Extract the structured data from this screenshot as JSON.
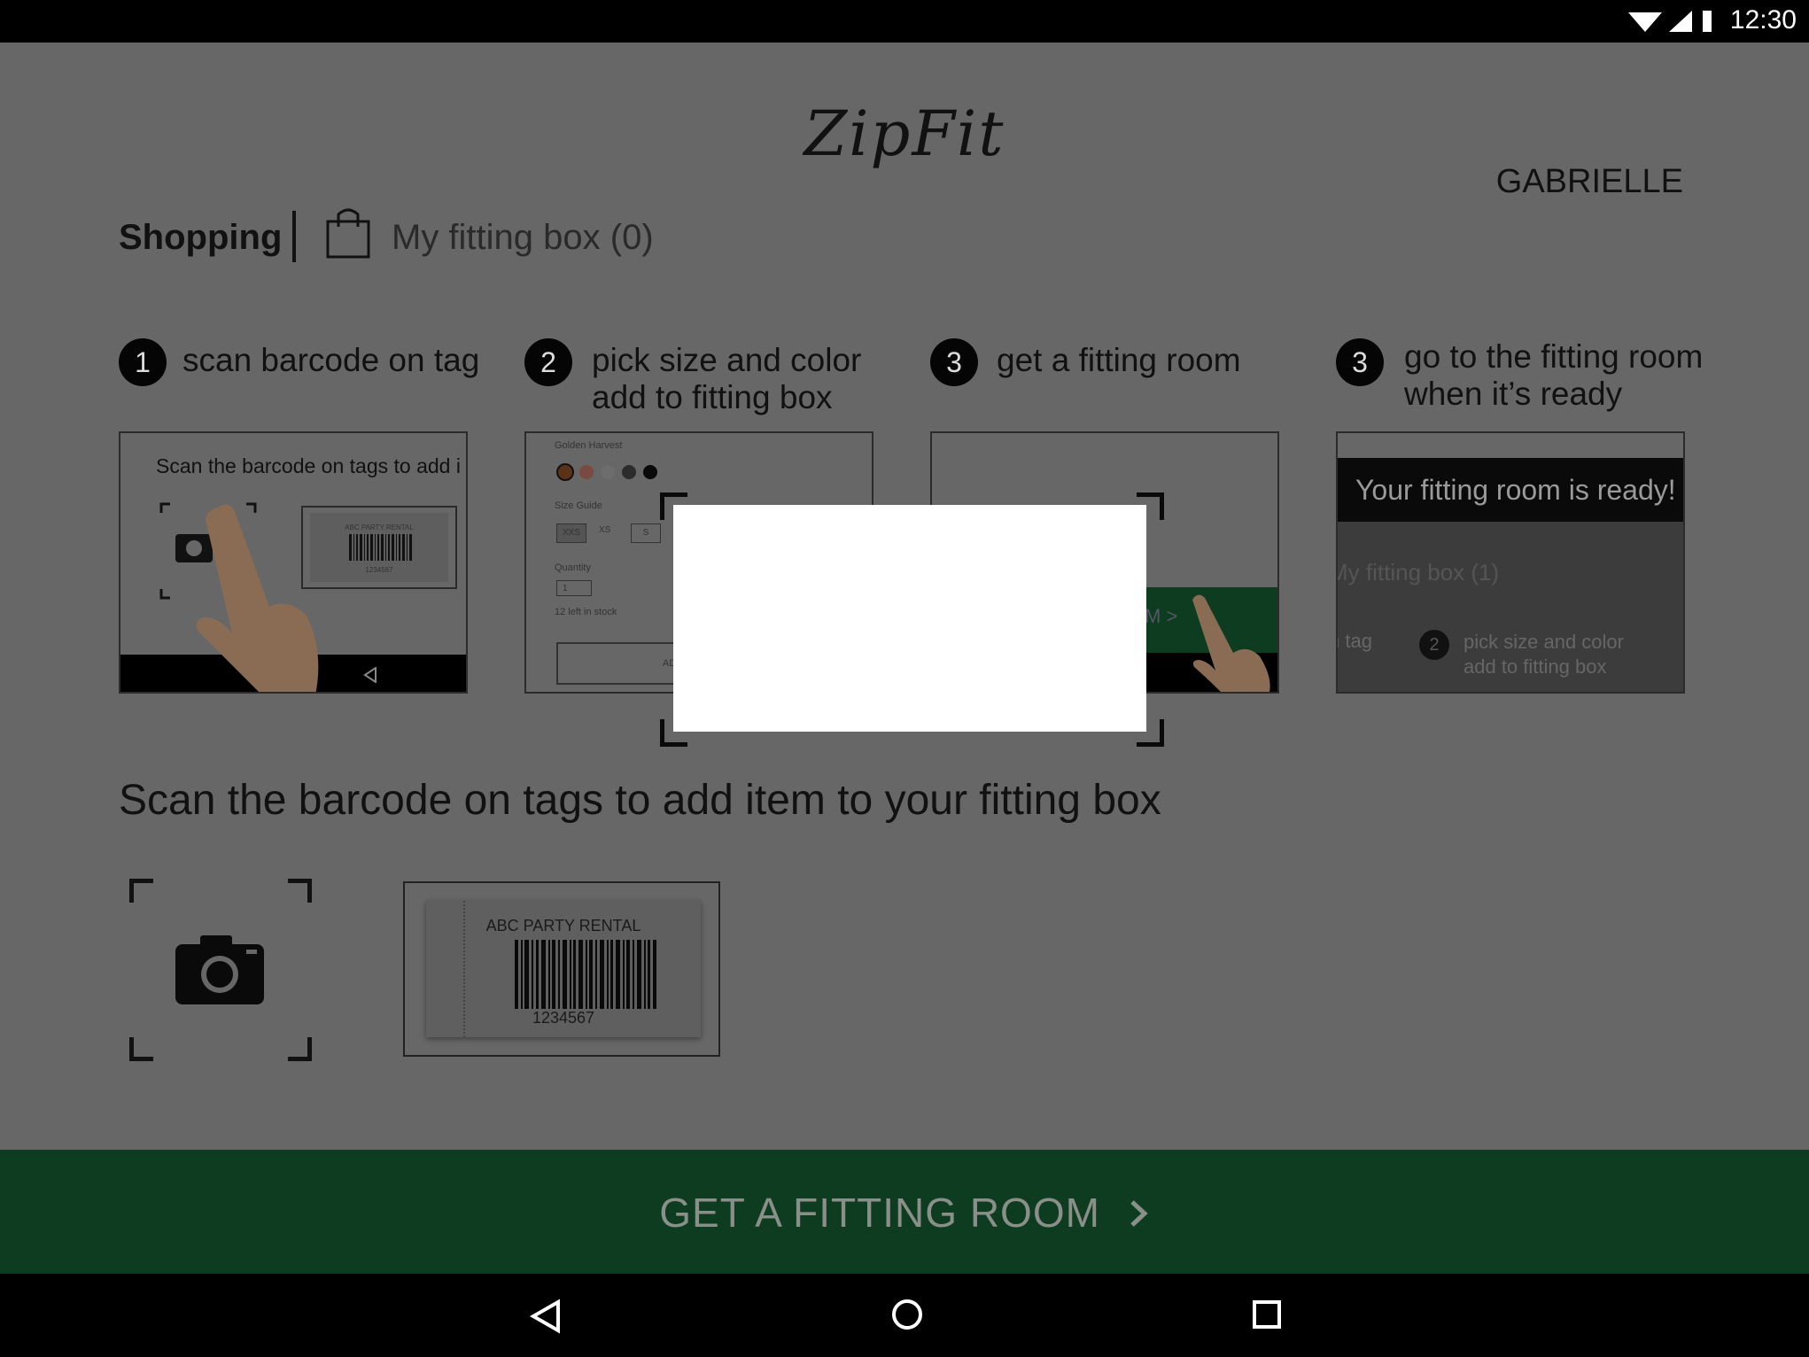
{
  "status_bar": {
    "time": "12:30"
  },
  "header": {
    "logo": "ZipFit",
    "user": "GABRIELLE"
  },
  "tabs": {
    "shopping": "Shopping",
    "fitting_box": "My fitting box (0)"
  },
  "steps": [
    {
      "number": "1",
      "text_line1": "scan barcode on tag",
      "text_line2": ""
    },
    {
      "number": "2",
      "text_line1": "pick size and color",
      "text_line2": "add to fitting box"
    },
    {
      "number": "3",
      "text_line1": "get a fitting room",
      "text_line2": ""
    },
    {
      "number": "3",
      "text_line1": "go to the fitting room",
      "text_line2": "when it’s ready"
    }
  ],
  "card1": {
    "text": "Scan the barcode on tags to add i",
    "tag_brand": "ABC PARTY RENTAL",
    "tag_code": "1234567"
  },
  "card2": {
    "product": "Golden Harvest",
    "size_guide": "Size Guide",
    "sizes": [
      "XXS",
      "XS",
      "S"
    ],
    "quantity_label": "Quantity",
    "quantity_value": "1",
    "stock": "12 left in stock",
    "button": "ADD TO"
  },
  "card3": {
    "button_fragment": "M >"
  },
  "card4": {
    "banner": "Your fitting room is ready!",
    "fitting_box": "My fitting box (1)",
    "tag_fragment": "n tag",
    "step_number": "2",
    "step_line1": "pick size and color",
    "step_line2": "add to fitting box"
  },
  "scan_section": {
    "title": "Scan the barcode on tags to add item to your fitting box",
    "tag_brand": "ABC PARTY RENTAL",
    "tag_code": "1234567"
  },
  "cta": {
    "label": "GET A FITTING ROOM"
  },
  "colors": {
    "cta_green": "#0d3c21",
    "dim_overlay": "#676767"
  }
}
